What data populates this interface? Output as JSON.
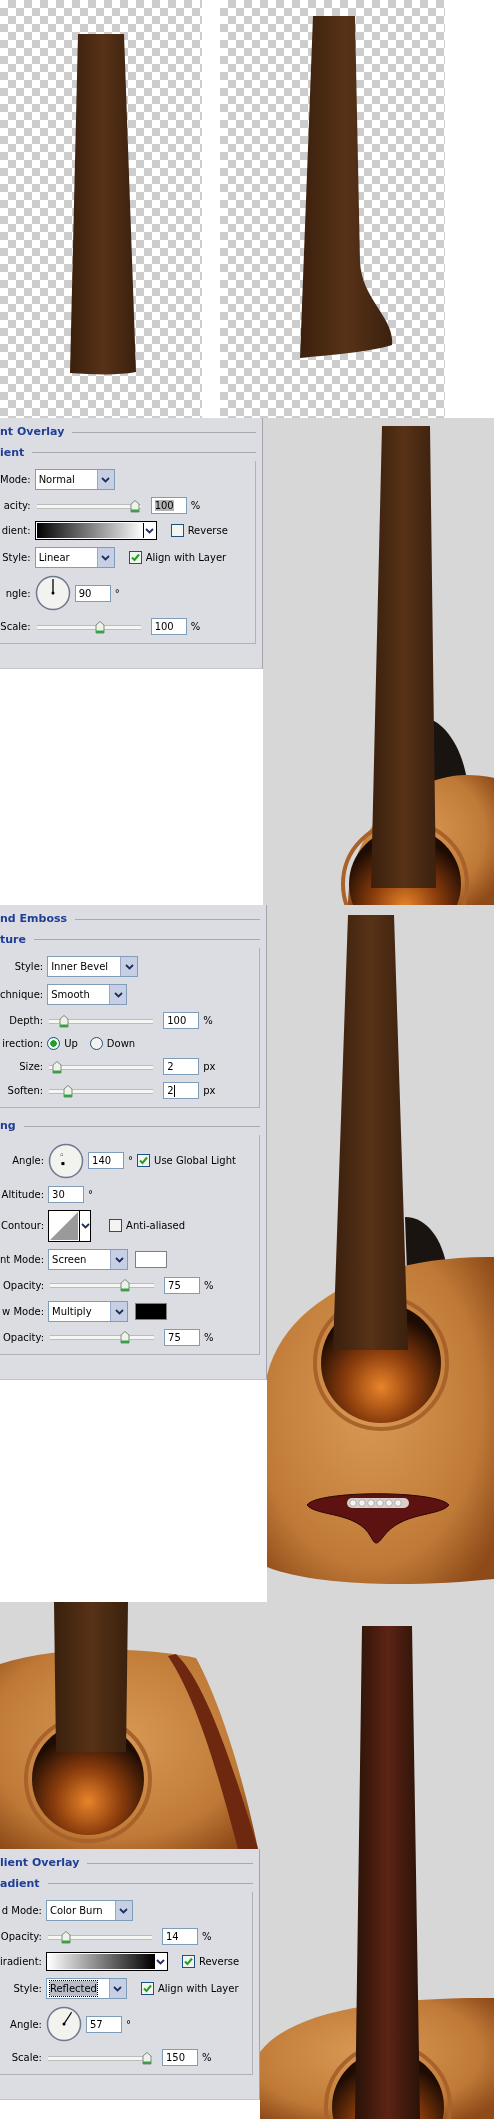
{
  "panels": [
    {
      "title": "nt Overlay",
      "sections": [
        {
          "title": "ient",
          "rows": [
            {
              "kind": "select",
              "label": "Mode:",
              "value": "Normal"
            },
            {
              "kind": "slider",
              "label": "acity:",
              "level": 1,
              "value": "100",
              "unit": "%",
              "highlighted": true
            },
            {
              "kind": "gradient",
              "label": "dient:",
              "checkbox": {
                "label": "Reverse",
                "checked": false
              }
            },
            {
              "kind": "select",
              "label": "Style:",
              "value": "Linear",
              "checkbox": {
                "label": "Align with Layer",
                "checked": true
              }
            },
            {
              "kind": "dial",
              "label": "ngle:",
              "value": "90",
              "unit": "°"
            },
            {
              "kind": "slider",
              "label": "Scale:",
              "level": 0.62,
              "value": "100",
              "unit": "%"
            }
          ]
        }
      ]
    },
    {
      "title": "nd Emboss",
      "sections": [
        {
          "title": "ture",
          "rows": [
            {
              "kind": "select",
              "label": "Style:",
              "value": "Inner Bevel"
            },
            {
              "kind": "select",
              "label": "chnique:",
              "value": "Smooth"
            },
            {
              "kind": "slider",
              "label": "Depth:",
              "level": 0.1,
              "value": "100",
              "unit": "%"
            },
            {
              "kind": "radio",
              "label": "irection:",
              "options": [
                {
                  "label": "Up",
                  "selected": true
                },
                {
                  "label": "Down",
                  "selected": false
                }
              ]
            },
            {
              "kind": "slider",
              "label": "Size:",
              "level": 0.03,
              "value": "2",
              "unit": "px"
            },
            {
              "kind": "slider",
              "label": "Soften:",
              "level": 0.15,
              "value": "2",
              "unit": "px",
              "focused": true
            }
          ]
        },
        {
          "title": "ng",
          "rows": [
            {
              "kind": "light-dial",
              "label": "Angle:",
              "value": "140",
              "unit": "°",
              "checkbox": {
                "label": "Use Global Light",
                "checked": true
              }
            },
            {
              "kind": "field",
              "label": "Altitude:",
              "value": "30",
              "unit": "°"
            },
            {
              "kind": "contour",
              "label": "Contour:",
              "checkbox": {
                "label": "Anti-aliased",
                "checked": false
              }
            },
            {
              "kind": "select",
              "label": "nt Mode:",
              "value": "Screen",
              "color": "#ffffff"
            },
            {
              "kind": "slider",
              "label": "Opacity:",
              "level": 0.75,
              "value": "75",
              "unit": "%"
            },
            {
              "kind": "select",
              "label": "w Mode:",
              "value": "Multiply",
              "color": "#000000"
            },
            {
              "kind": "slider",
              "label": "Opacity:",
              "level": 0.75,
              "value": "75",
              "unit": "%"
            }
          ]
        }
      ]
    },
    {
      "title": "lient Overlay",
      "sections": [
        {
          "title": "adient",
          "rows": [
            {
              "kind": "select",
              "label": "d Mode:",
              "value": "Color Burn"
            },
            {
              "kind": "slider",
              "label": "Opacity:",
              "level": 0.14,
              "value": "14",
              "unit": "%"
            },
            {
              "kind": "gradient",
              "label": "iradient:",
              "checkbox": {
                "label": "Reverse",
                "checked": true
              }
            },
            {
              "kind": "select",
              "label": "Style:",
              "value": "Reflected",
              "focused": true,
              "checkbox": {
                "label": "Align with Layer",
                "checked": true
              }
            },
            {
              "kind": "dial",
              "label": "Angle:",
              "value": "57",
              "unit": "°"
            },
            {
              "kind": "slider",
              "label": "Scale:",
              "level": 1,
              "value": "150",
              "unit": "%"
            }
          ]
        }
      ]
    }
  ]
}
